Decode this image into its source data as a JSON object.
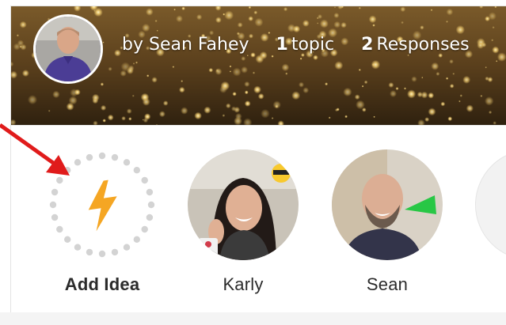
{
  "header": {
    "author_prefix": "by Sean Fahey",
    "topic_count": "1",
    "topic_word": "topic",
    "response_count": "2",
    "response_word": "Responses"
  },
  "ideas": {
    "add_label": "Add Idea",
    "people": [
      {
        "name": "Karly"
      },
      {
        "name": "Sean"
      }
    ]
  },
  "colors": {
    "accent_bolt": "#f5a623",
    "arrow": "#e01b1b",
    "avatar_shirt": "#4b3d95"
  },
  "icons": {
    "add": "lightning-bolt-icon",
    "annotation": "red-arrow-icon"
  }
}
